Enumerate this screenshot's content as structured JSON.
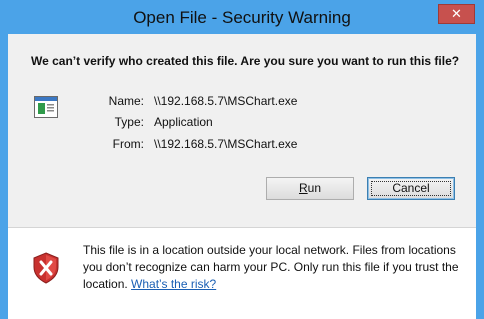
{
  "window": {
    "title": "Open File - Security Warning",
    "close_label": "✕"
  },
  "heading": "We can’t verify who created this file. Are you sure you want to run this file?",
  "file": {
    "icon": "application-icon",
    "rows": [
      {
        "label": "Name:",
        "value": "\\\\192.168.5.7\\MSChart.exe"
      },
      {
        "label": "Type:",
        "value": "Application"
      },
      {
        "label": "From:",
        "value": "\\\\192.168.5.7\\MSChart.exe"
      }
    ]
  },
  "buttons": {
    "run_hotkey": "R",
    "run_rest": "un",
    "cancel": "Cancel"
  },
  "footer": {
    "icon": "shield-warning-icon",
    "message": "This file is in a location outside your local network. Files from locations you don’t recognize can harm your PC. Only run this file if you trust the location.",
    "link": "What’s the risk?"
  },
  "colors": {
    "title_bar": "#4ba3e8",
    "close_button": "#c7514e",
    "link": "#1a5fb4"
  }
}
